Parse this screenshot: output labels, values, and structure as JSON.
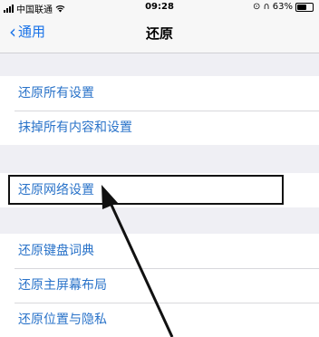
{
  "status_bar": {
    "carrier": "中国联通",
    "wifi_icon": "wifi-icon",
    "time": "09:28",
    "battery_percent": "63%",
    "battery_level": 0.63
  },
  "nav": {
    "back_label": "通用",
    "back_icon": "chevron-left-icon",
    "title": "还原"
  },
  "groups": [
    {
      "items": [
        {
          "label": "还原所有设置"
        },
        {
          "label": "抹掉所有内容和设置"
        }
      ]
    },
    {
      "items": [
        {
          "label": "还原网络设置",
          "highlighted": true
        }
      ]
    },
    {
      "items": [
        {
          "label": "还原键盘词典"
        },
        {
          "label": "还原主屏幕布局"
        },
        {
          "label": "还原位置与隐私"
        }
      ]
    }
  ],
  "colors": {
    "accent": "#2a73c9",
    "background": "#efeff4",
    "annotation": "#111111"
  }
}
